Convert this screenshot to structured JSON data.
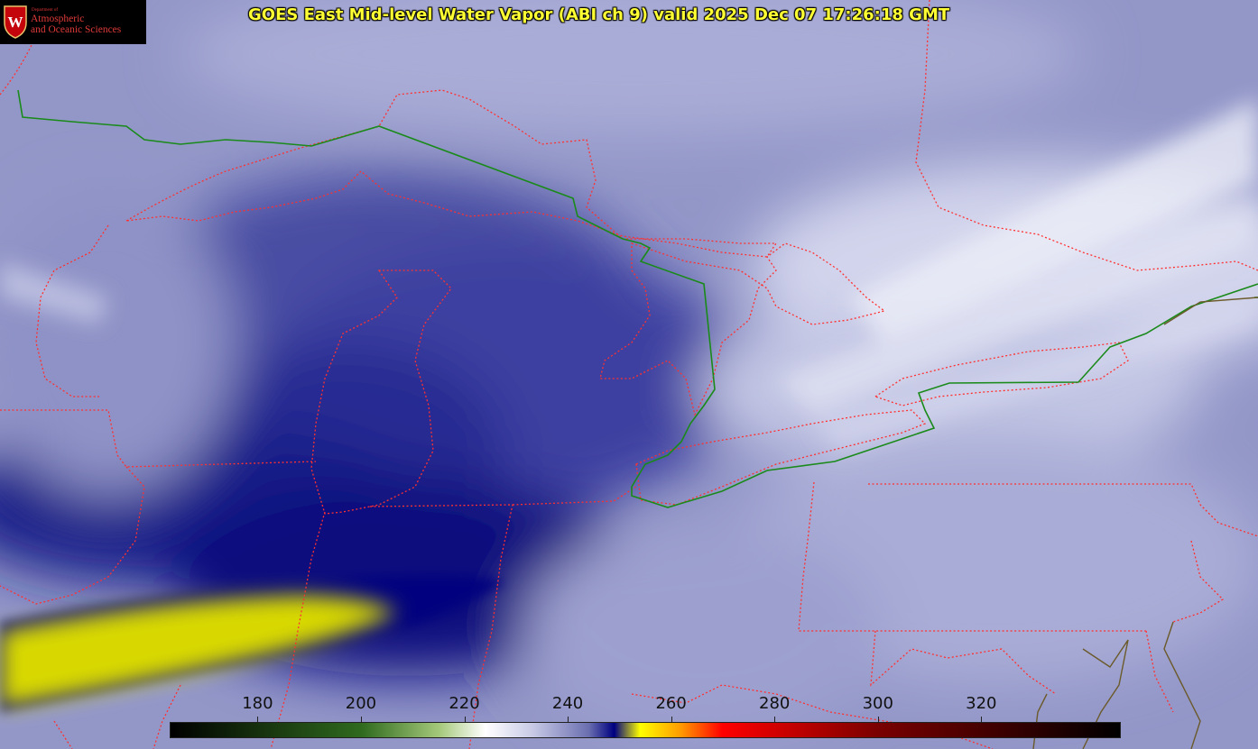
{
  "title": "GOES East Mid-level Water Vapor (ABI ch 9)  valid 2025 Dec 07 17:26:18 GMT",
  "logo": {
    "line_small": "Department of",
    "line1": "Atmospheric",
    "line2": "and Oceanic Sciences",
    "crest_letter": "W"
  },
  "colorbar": {
    "ticks": [
      "180",
      "200",
      "220",
      "240",
      "260",
      "280",
      "300",
      "320"
    ],
    "min": 163,
    "max": 347,
    "stops": [
      {
        "v": 163,
        "c": "#000000"
      },
      {
        "v": 200,
        "c": "#2f6a1e"
      },
      {
        "v": 215,
        "c": "#a4c87a"
      },
      {
        "v": 224,
        "c": "#ffffff"
      },
      {
        "v": 233,
        "c": "#c9cbe6"
      },
      {
        "v": 244,
        "c": "#6b6fb0"
      },
      {
        "v": 249,
        "c": "#000080"
      },
      {
        "v": 254,
        "c": "#ffff00"
      },
      {
        "v": 262,
        "c": "#ff9900"
      },
      {
        "v": 270,
        "c": "#ff0000"
      },
      {
        "v": 300,
        "c": "#7a0000"
      },
      {
        "v": 347,
        "c": "#000000"
      }
    ]
  },
  "colors": {
    "state_borders": "#ff3030",
    "intl_border": "#1a8a1a",
    "coast": "#6b5a2a"
  }
}
